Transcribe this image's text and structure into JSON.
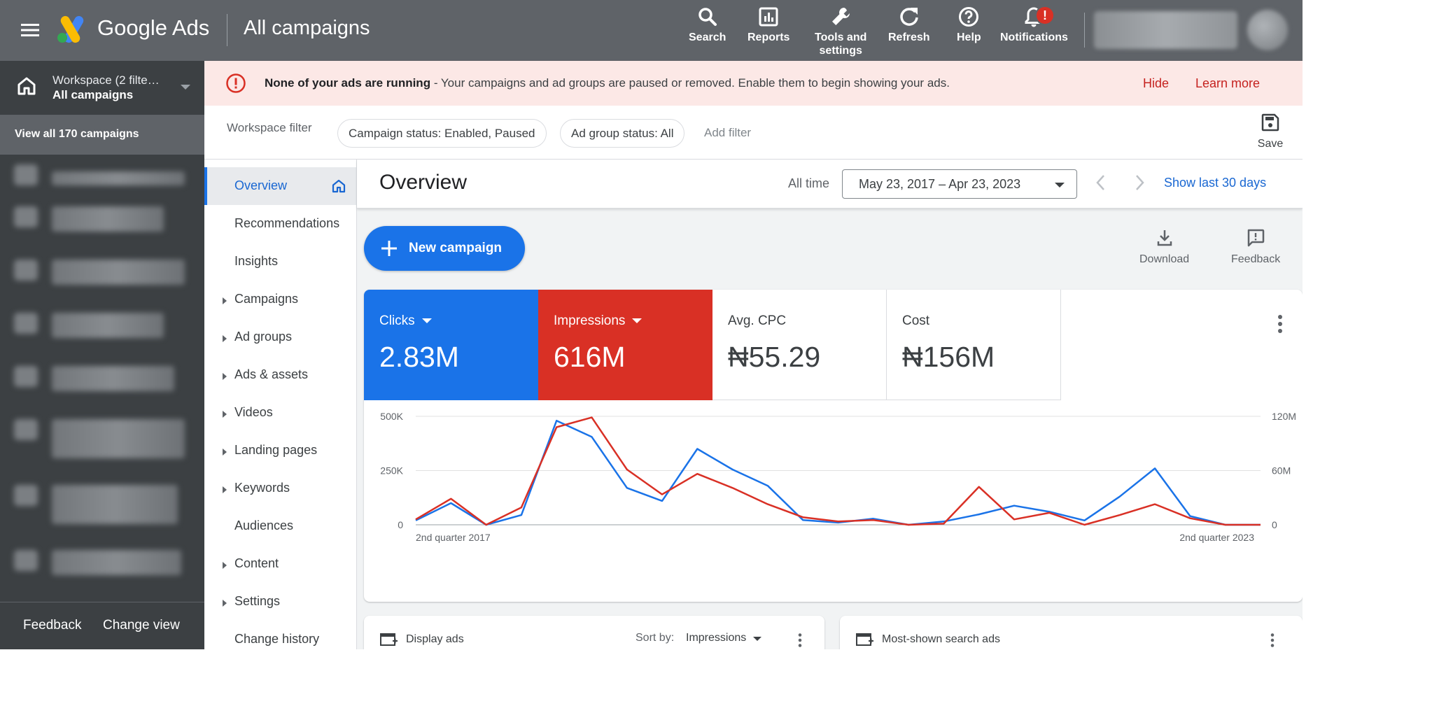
{
  "header": {
    "brand": "Google Ads",
    "page_title": "All campaigns",
    "tools": [
      {
        "label": "Search",
        "icon": "search-icon"
      },
      {
        "label": "Reports",
        "icon": "reports-icon"
      },
      {
        "label": "Tools and\nsettings",
        "icon": "wrench-icon"
      },
      {
        "label": "Refresh",
        "icon": "refresh-icon"
      },
      {
        "label": "Help",
        "icon": "help-icon"
      },
      {
        "label": "Notifications",
        "icon": "bell-icon"
      }
    ],
    "notification_badge": "!"
  },
  "left_nav": {
    "workspace_title": "Workspace (2 filte…",
    "workspace_sub": "All campaigns",
    "view_all": "View all 170 campaigns",
    "footer_feedback": "Feedback",
    "footer_change_view": "Change view"
  },
  "alert": {
    "bold": "None of your ads are running",
    "text": " - Your campaigns and ad groups are paused or removed. Enable them to begin showing your ads.",
    "hide": "Hide",
    "learn_more": "Learn more"
  },
  "filters": {
    "label": "Workspace filter",
    "chips": [
      "Campaign status: Enabled, Paused",
      "Ad group status: All"
    ],
    "add_filter": "Add filter",
    "save": "Save"
  },
  "page_nav": [
    {
      "label": "Overview",
      "expandable": false,
      "active": true
    },
    {
      "label": "Recommendations",
      "expandable": false
    },
    {
      "label": "Insights",
      "expandable": false
    },
    {
      "label": "Campaigns",
      "expandable": true
    },
    {
      "label": "Ad groups",
      "expandable": true
    },
    {
      "label": "Ads & assets",
      "expandable": true
    },
    {
      "label": "Videos",
      "expandable": true
    },
    {
      "label": "Landing pages",
      "expandable": true
    },
    {
      "label": "Keywords",
      "expandable": true
    },
    {
      "label": "Audiences",
      "expandable": false
    },
    {
      "label": "Content",
      "expandable": true
    },
    {
      "label": "Settings",
      "expandable": true
    },
    {
      "label": "Change history",
      "expandable": false
    }
  ],
  "overview": {
    "title": "Overview",
    "all_time": "All time",
    "date_range": "May 23, 2017 – Apr 23, 2023",
    "show_last_30": "Show last 30 days",
    "new_campaign": "New campaign",
    "download": "Download",
    "feedback": "Feedback"
  },
  "scorecards": [
    {
      "label": "Clicks",
      "value": "2.83M",
      "color": "#1a73e8",
      "dropdown": true
    },
    {
      "label": "Impressions",
      "value": "616M",
      "color": "#d93025",
      "dropdown": true
    },
    {
      "label": "Avg. CPC",
      "value": "₦55.29"
    },
    {
      "label": "Cost",
      "value": "₦156M"
    }
  ],
  "chart_data": {
    "type": "line",
    "x_labels": [
      "2nd quarter 2017",
      "2nd quarter 2023"
    ],
    "left_axis": {
      "ticks": [
        "0",
        "250K",
        "500K"
      ],
      "min": 0,
      "max": 500000
    },
    "right_axis": {
      "ticks": [
        "0",
        "60M",
        "120M"
      ],
      "min": 0,
      "max": 120000000
    },
    "grid": true,
    "series": [
      {
        "name": "Clicks",
        "axis": "left",
        "color": "#1a73e8",
        "values": [
          20000,
          100000,
          0,
          45000,
          480000,
          405000,
          170000,
          110000,
          350000,
          255000,
          180000,
          22000,
          10000,
          28000,
          0,
          15000,
          48000,
          88000,
          60000,
          20000,
          130000,
          260000,
          40000,
          0,
          0
        ]
      },
      {
        "name": "Impressions",
        "axis": "left",
        "color": "#d93025",
        "values": [
          25000,
          120000,
          0,
          80000,
          450000,
          495000,
          255000,
          140000,
          235000,
          170000,
          95000,
          35000,
          15000,
          22000,
          0,
          5000,
          175000,
          25000,
          55000,
          0,
          45000,
          95000,
          30000,
          0,
          0
        ]
      }
    ]
  },
  "bottom_cards": {
    "display_ads": "Display ads",
    "sort_by": "Sort by:",
    "sort_value": "Impressions",
    "search_ads": "Most-shown search ads"
  }
}
